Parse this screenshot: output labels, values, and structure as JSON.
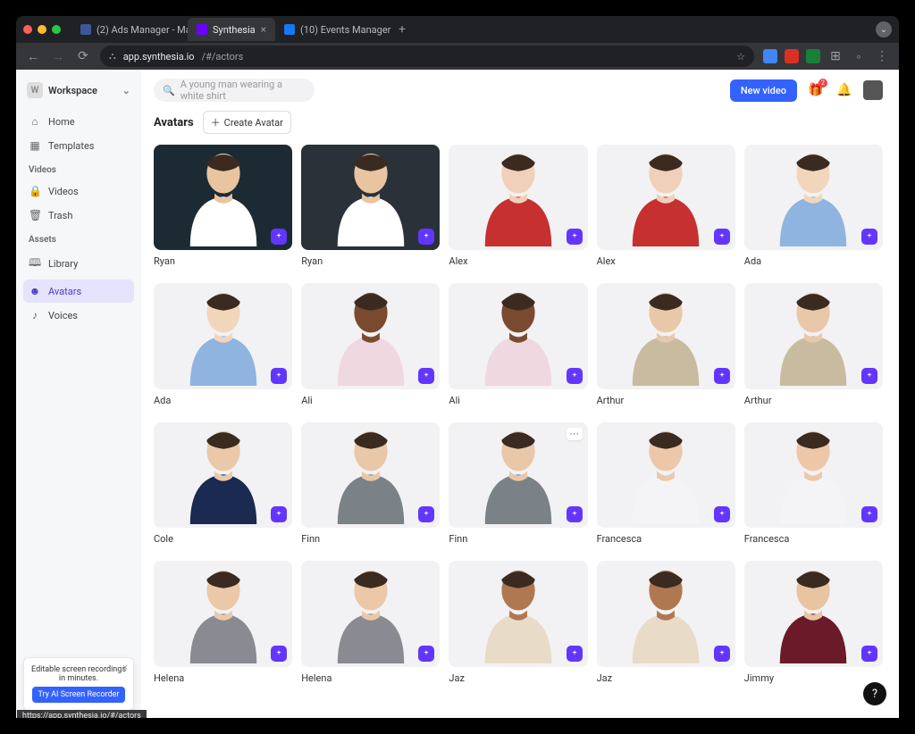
{
  "browser": {
    "tabs": [
      {
        "label": "(2) Ads Manager - Manage a",
        "active": false
      },
      {
        "label": "Synthesia",
        "active": true
      },
      {
        "label": "(10) Events Manager",
        "active": false
      }
    ],
    "url_prefix": "app.synthesia.io",
    "url_path": "/#/actors",
    "status_url": "https://app.synthesia.io/#/actors"
  },
  "workspace": {
    "label": "Workspace",
    "initial": "W"
  },
  "sidebar": {
    "items": [
      {
        "icon": "home",
        "label": "Home"
      },
      {
        "icon": "templates",
        "label": "Templates"
      }
    ],
    "videos_head": "Videos",
    "videos": [
      {
        "icon": "lock",
        "label": "Videos"
      },
      {
        "icon": "trash",
        "label": "Trash"
      }
    ],
    "assets_head": "Assets",
    "assets": [
      {
        "icon": "library",
        "label": "Library"
      },
      {
        "icon": "avatars",
        "label": "Avatars",
        "active": true
      },
      {
        "icon": "voices",
        "label": "Voices"
      }
    ]
  },
  "topbar": {
    "search_placeholder": "A young man wearing a white shirt",
    "new_video": "New video",
    "gift_badge": "2"
  },
  "page": {
    "title": "Avatars",
    "create_label": "Create Avatar"
  },
  "avatars": [
    {
      "name": "Ryan",
      "bg": "#1c2b33",
      "skin": "#e8c4a0",
      "shirt": "#ffffff",
      "scene": true
    },
    {
      "name": "Ryan",
      "bg": "#2a3138",
      "skin": "#e8c4a0",
      "shirt": "#ffffff",
      "scene": true
    },
    {
      "name": "Alex",
      "bg": "#f2f2f4",
      "skin": "#f0d0b8",
      "shirt": "#c63030"
    },
    {
      "name": "Alex",
      "bg": "#f2f2f4",
      "skin": "#f0d0b8",
      "shirt": "#c63030"
    },
    {
      "name": "Ada",
      "bg": "#f2f2f4",
      "skin": "#f2d6bc",
      "shirt": "#8fb4e0"
    },
    {
      "name": "Ada",
      "bg": "#f2f2f4",
      "skin": "#f2d6bc",
      "shirt": "#8fb4e0"
    },
    {
      "name": "Ali",
      "bg": "#f2f2f4",
      "skin": "#7a4a30",
      "shirt": "#f0d8e0"
    },
    {
      "name": "Ali",
      "bg": "#f2f2f4",
      "skin": "#7a4a30",
      "shirt": "#f0d8e0"
    },
    {
      "name": "Arthur",
      "bg": "#f2f2f4",
      "skin": "#e8c8a8",
      "shirt": "#c8bba0"
    },
    {
      "name": "Arthur",
      "bg": "#f2f2f4",
      "skin": "#e8c8a8",
      "shirt": "#c8bba0"
    },
    {
      "name": "Cole",
      "bg": "#f2f2f4",
      "skin": "#eac8a8",
      "shirt": "#1a2a50"
    },
    {
      "name": "Finn",
      "bg": "#f2f2f4",
      "skin": "#e8c8a8",
      "shirt": "#7a8288"
    },
    {
      "name": "Finn",
      "bg": "#f2f2f4",
      "skin": "#e8c8a8",
      "shirt": "#7a8288",
      "hover": true
    },
    {
      "name": "Francesca",
      "bg": "#f2f2f4",
      "skin": "#ecc8a8",
      "shirt": "#f4f4f6"
    },
    {
      "name": "Francesca",
      "bg": "#f2f2f4",
      "skin": "#ecc8a8",
      "shirt": "#f4f4f6"
    },
    {
      "name": "Helena",
      "bg": "#f2f2f4",
      "skin": "#ecc8a8",
      "shirt": "#8a8a92"
    },
    {
      "name": "Helena",
      "bg": "#f2f2f4",
      "skin": "#ecc8a8",
      "shirt": "#8a8a92"
    },
    {
      "name": "Jaz",
      "bg": "#f2f2f4",
      "skin": "#b07850",
      "shirt": "#e8dcc8"
    },
    {
      "name": "Jaz",
      "bg": "#f2f2f4",
      "skin": "#b07850",
      "shirt": "#e8dcc8"
    },
    {
      "name": "Jimmy",
      "bg": "#f2f2f4",
      "skin": "#e8c4a0",
      "shirt": "#6a1a28"
    }
  ],
  "promo": {
    "text": "Editable screen recordings in minutes.",
    "cta": "Try AI Screen Recorder"
  },
  "help": "?",
  "colors": {
    "accent": "#6236ff",
    "primary": "#3462ff"
  }
}
